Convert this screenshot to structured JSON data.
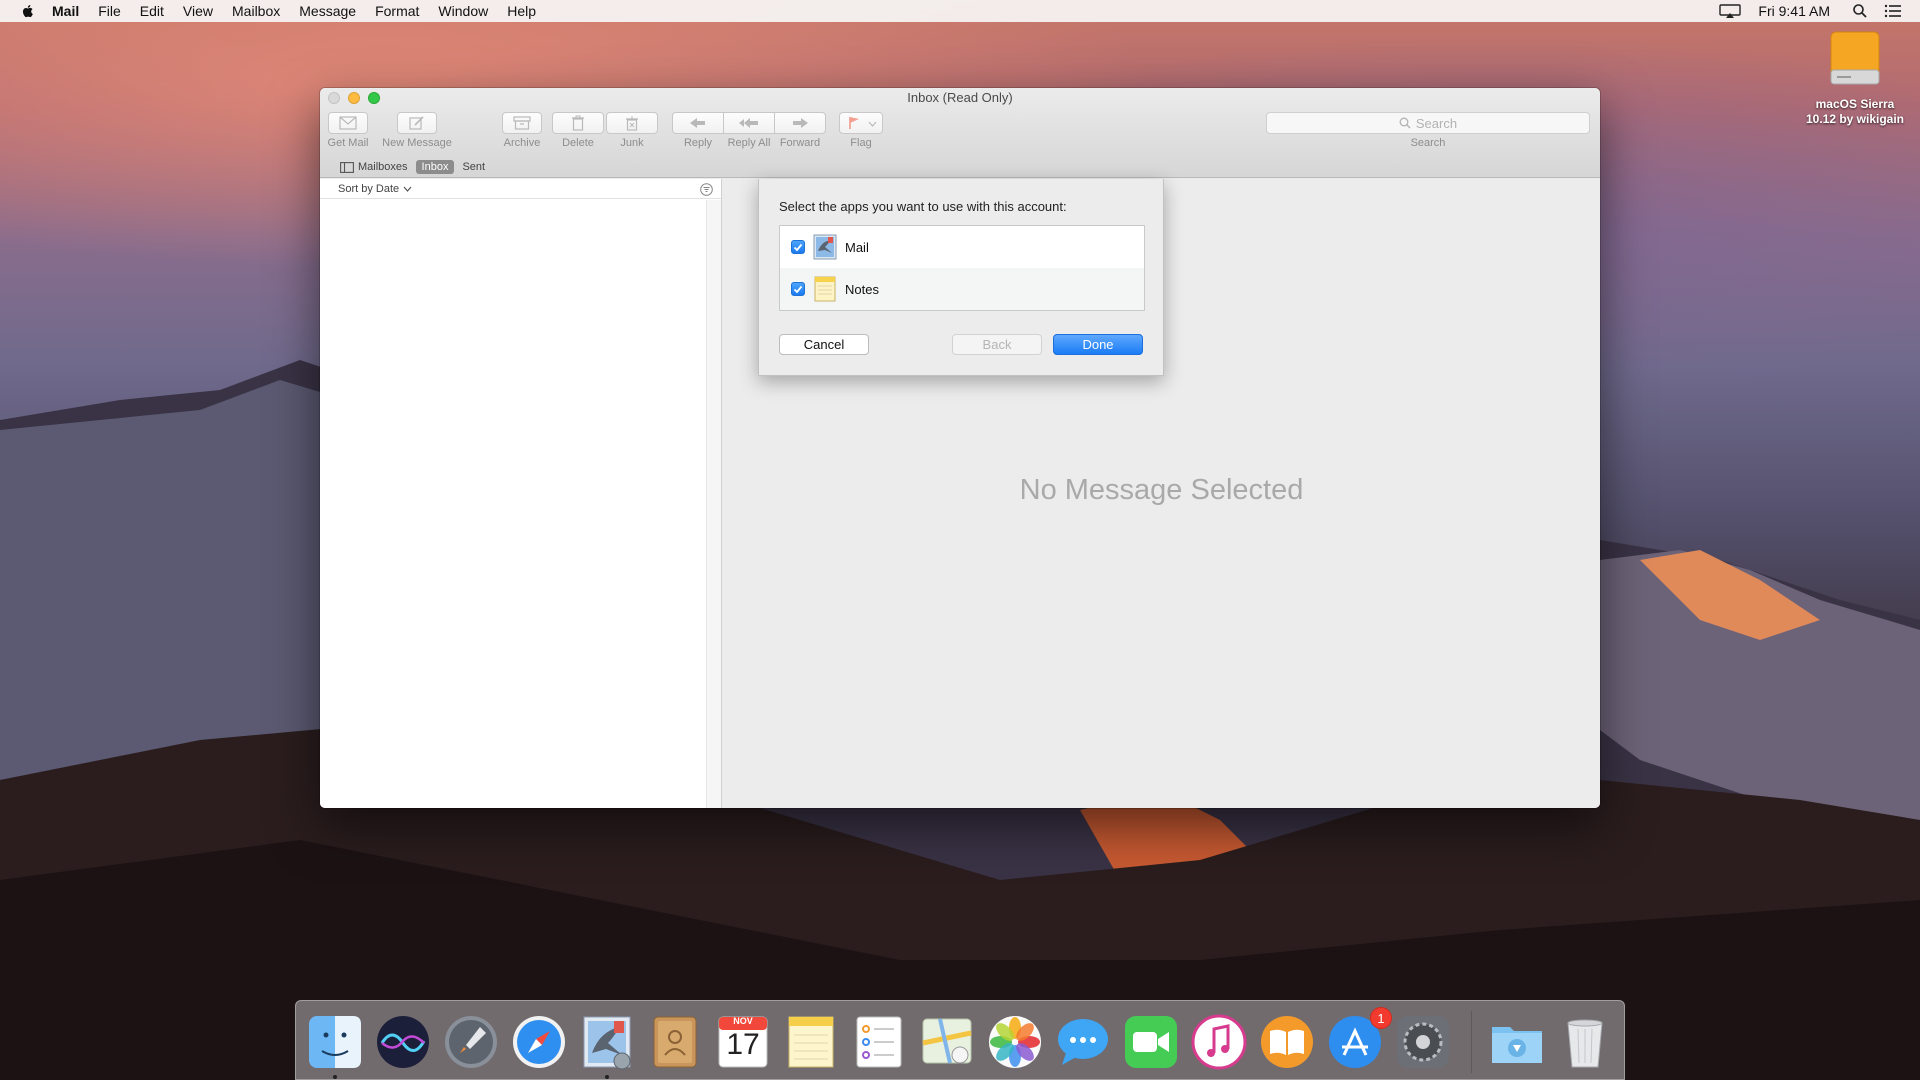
{
  "menubar": {
    "apple_icon": "apple-icon",
    "app_name": "Mail",
    "items": [
      "File",
      "Edit",
      "View",
      "Mailbox",
      "Message",
      "Format",
      "Window",
      "Help"
    ],
    "clock": "Fri 9:41 AM",
    "status_icons": [
      "airplay-icon",
      "spotlight-icon",
      "notification-center-icon"
    ]
  },
  "desktop": {
    "drive_label_line1": "macOS Sierra",
    "drive_label_line2": "10.12 by wikigain",
    "drive_color": "#f5a623"
  },
  "window": {
    "title": "Inbox (Read Only)",
    "toolbar": {
      "get_mail": "Get Mail",
      "new_message": "New Message",
      "archive": "Archive",
      "delete": "Delete",
      "junk": "Junk",
      "reply": "Reply",
      "reply_all": "Reply All",
      "forward": "Forward",
      "flag": "Flag",
      "search_placeholder": "Search",
      "search_label": "Search"
    },
    "favorites": {
      "mailboxes": "Mailboxes",
      "inbox": "Inbox",
      "sent": "Sent"
    },
    "sort_label": "Sort by Date",
    "empty_state": "No Message Selected"
  },
  "sheet": {
    "prompt": "Select the apps you want to use with this account:",
    "apps": [
      {
        "name": "Mail",
        "checked": true,
        "icon": "mail-app-icon"
      },
      {
        "name": "Notes",
        "checked": true,
        "icon": "notes-app-icon"
      }
    ],
    "cancel": "Cancel",
    "back": "Back",
    "done": "Done",
    "accent": "#1a7cf5"
  },
  "dock": {
    "apps": [
      "Finder",
      "Siri",
      "Launchpad",
      "Safari",
      "Mail",
      "Contacts",
      "Calendar",
      "Notes",
      "Reminders",
      "Maps",
      "Photos",
      "Messages",
      "FaceTime",
      "iTunes",
      "iBooks",
      "App Store",
      "System Preferences",
      "Downloads",
      "Trash"
    ],
    "calendar_month": "NOV",
    "calendar_day": "17",
    "app_store_badge": "1"
  }
}
